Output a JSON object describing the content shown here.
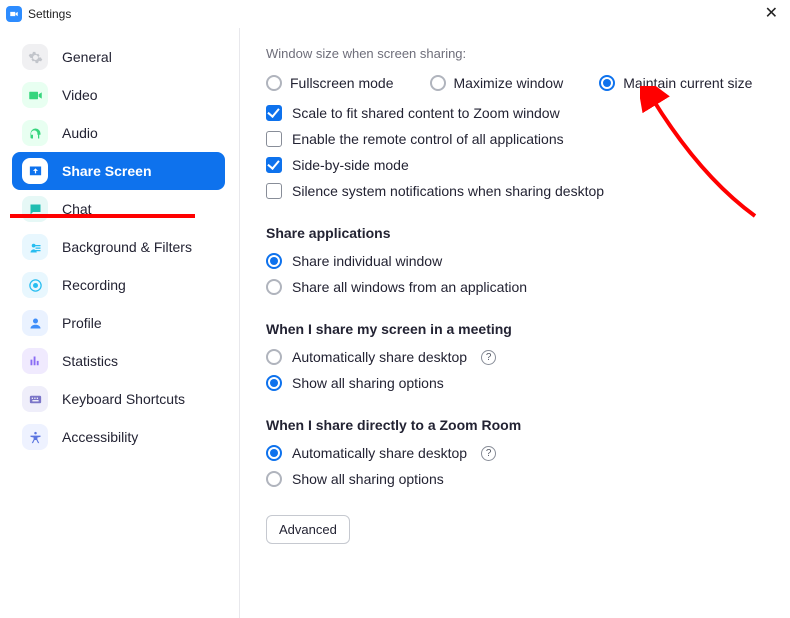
{
  "window": {
    "title": "Settings"
  },
  "sidebar": {
    "items": [
      {
        "label": "General"
      },
      {
        "label": "Video"
      },
      {
        "label": "Audio"
      },
      {
        "label": "Share Screen"
      },
      {
        "label": "Chat"
      },
      {
        "label": "Background & Filters"
      },
      {
        "label": "Recording"
      },
      {
        "label": "Profile"
      },
      {
        "label": "Statistics"
      },
      {
        "label": "Keyboard Shortcuts"
      },
      {
        "label": "Accessibility"
      }
    ]
  },
  "main": {
    "window_size_label": "Window size when screen sharing:",
    "window_size_options": {
      "fullscreen": "Fullscreen mode",
      "maximize": "Maximize window",
      "maintain": "Maintain current size"
    },
    "checkboxes": {
      "scale": "Scale to fit shared content to Zoom window",
      "remote": "Enable the remote control of all applications",
      "sbs": "Side-by-side mode",
      "silence": "Silence system notifications when sharing desktop"
    },
    "share_apps_title": "Share applications",
    "share_apps": {
      "individual": "Share individual window",
      "all": "Share all windows from an application"
    },
    "meeting_title": "When I share my screen in a meeting",
    "meeting": {
      "auto": "Automatically share desktop",
      "show": "Show all sharing options"
    },
    "zoomroom_title": "When I share directly to a Zoom Room",
    "zoomroom": {
      "auto": "Automatically share desktop",
      "show": "Show all sharing options"
    },
    "advanced_button": "Advanced"
  }
}
